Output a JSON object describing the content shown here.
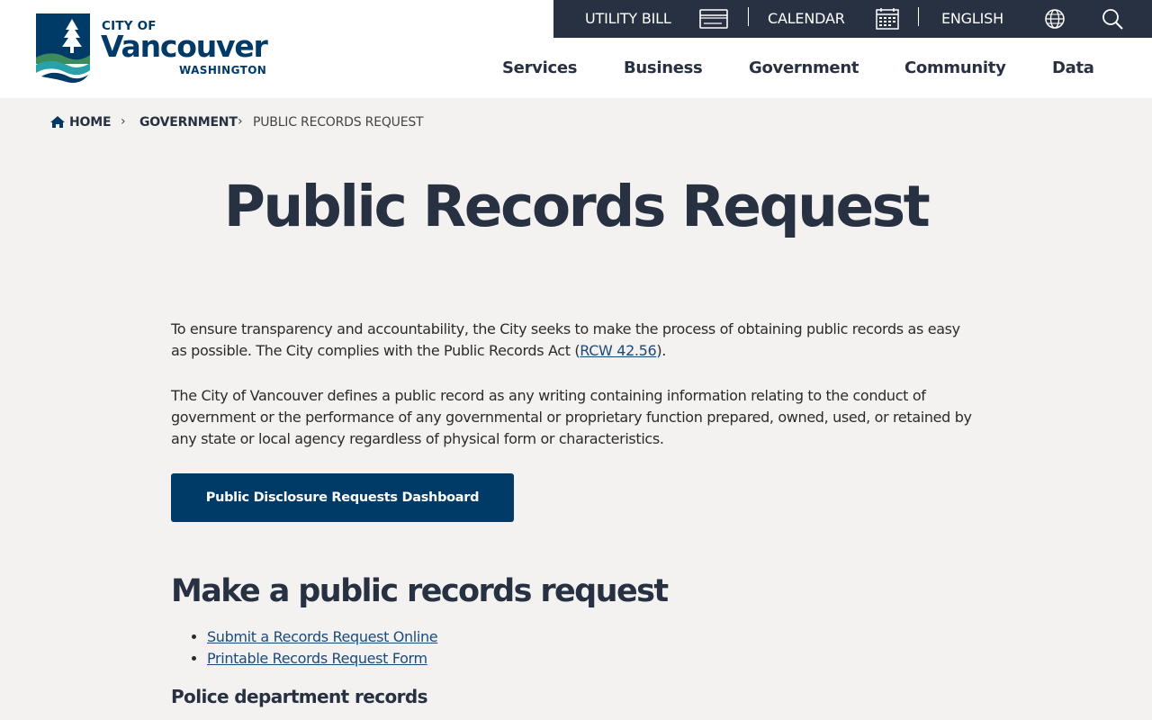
{
  "colors": {
    "navy": "#003a66",
    "utility_bar": "#283142",
    "page_bg": "#f4f2f0",
    "header_bg": "#ffffff",
    "link": "#1c4a7a",
    "logo_teal": "#2aa0a8",
    "logo_green": "#3d8a5a"
  },
  "logo": {
    "line1": "CITY OF",
    "line2": "Vancouver",
    "line3": "WASHINGTON"
  },
  "utility": {
    "utility_bill": "UTILITY BILL",
    "utility_bill_icon": "credit-card-icon",
    "calendar": "CALENDAR",
    "calendar_icon": "calendar-icon",
    "language": "ENGLISH",
    "language_icon": "globe-icon",
    "search_icon": "search-icon"
  },
  "nav": {
    "services": "Services",
    "business": "Business",
    "government": "Government",
    "community": "Community",
    "data": "Data"
  },
  "breadcrumb": {
    "home": "HOME",
    "home_icon": "home-icon",
    "government": "GOVERNMENT",
    "current": "PUBLIC RECORDS REQUEST",
    "separator": "›"
  },
  "main": {
    "title": "Public Records Request",
    "para1_before": "To ensure transparency and accountability, the City seeks to make the process of obtaining public records as easy as possible. The City complies with the Public Records Act (",
    "para1_link": "RCW 42.56",
    "para1_after": ").",
    "para2": "The City of Vancouver defines a public record as any writing containing information relating to the conduct of government or the performance of any governmental or proprietary function prepared, owned, used, or retained by any state or local agency regardless of physical form or characteristics.",
    "cta_label": "Public Disclosure Requests Dashboard",
    "section_heading": "Make a public records request",
    "links": [
      "Submit a Records Request Online",
      "Printable Records Request Form"
    ],
    "subheading": "Police department records"
  }
}
